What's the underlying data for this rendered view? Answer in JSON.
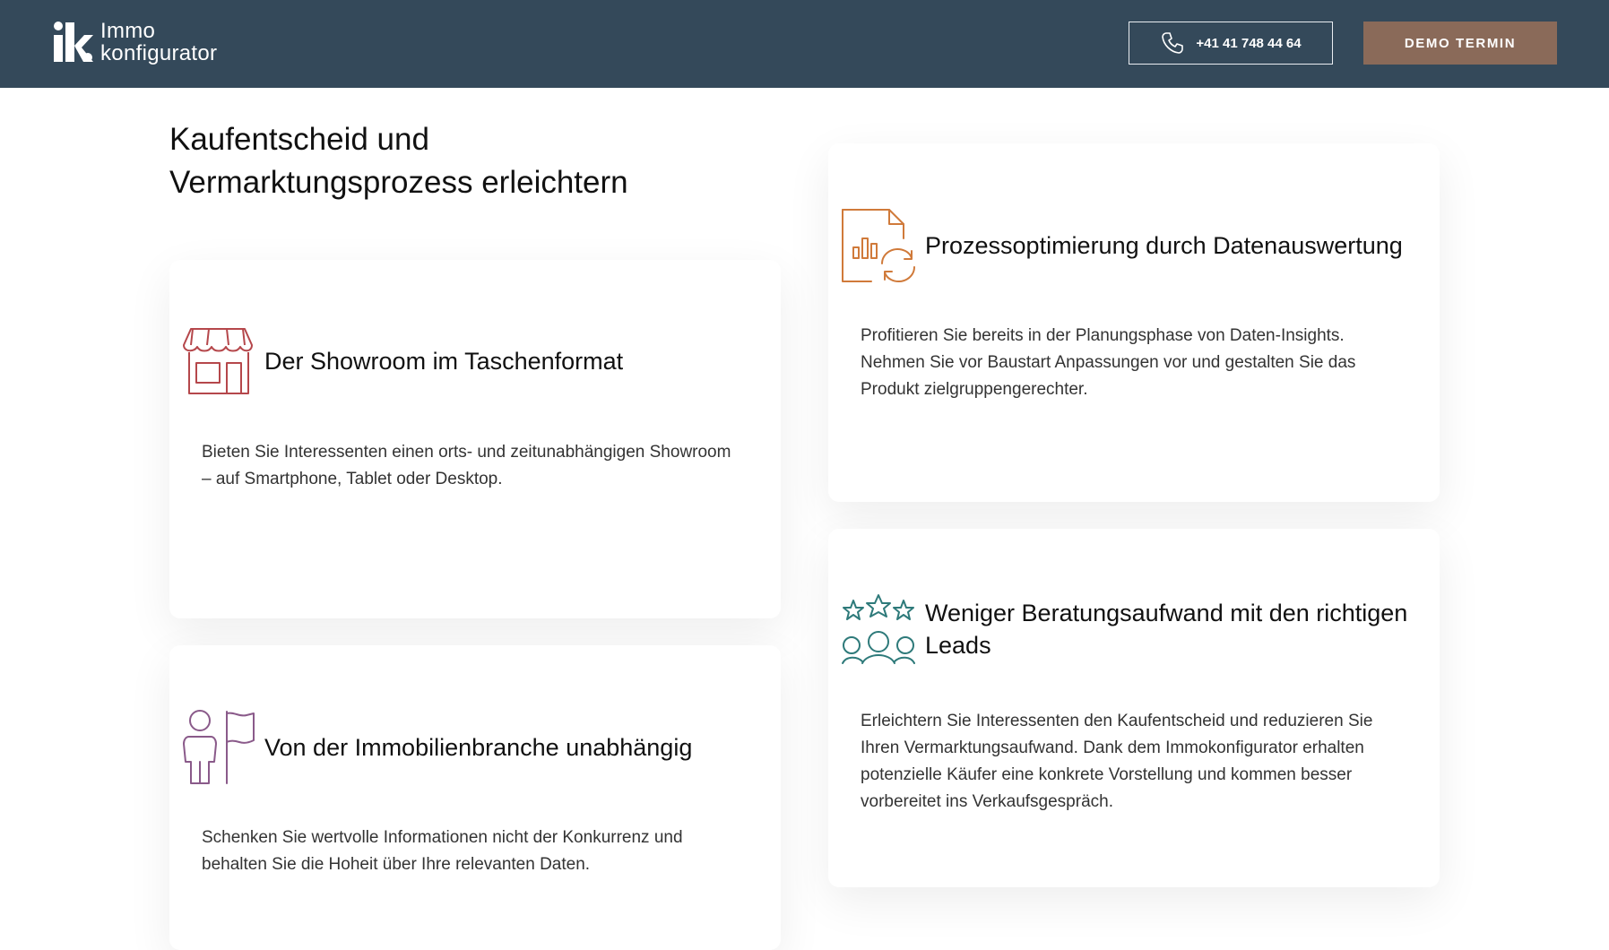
{
  "header": {
    "logo_line1": "Immo",
    "logo_line2": "konfigurator",
    "phone_label": "+41 41 748 44 64",
    "demo_label": "DEMO TERMIN"
  },
  "main": {
    "title_line1": "Kaufentscheid und",
    "title_line2": "Vermarktungsprozess erleichtern",
    "cards": [
      {
        "icon": "showroom-store-icon",
        "title": "Der Showroom im Taschenformat",
        "text_line1": "Bieten Sie Interessenten einen orts- und zeitunabhängigen Showroom",
        "text_line2": "– auf Smartphone, Tablet oder Desktop."
      },
      {
        "icon": "data-chart-refresh-icon",
        "title": "Prozessoptimierung durch Datenauswertung",
        "text_line1": "Profitieren Sie bereits in der Planungsphase von Daten-Insights.",
        "text_line2": "Nehmen Sie vor Baustart Anpassungen vor und gestalten Sie das",
        "text_line3": "Produkt zielgruppengerechter."
      },
      {
        "icon": "person-flag-icon",
        "title": "Von der Immobilienbranche unabhängig",
        "text_line1": "Schenken Sie wertvolle Informationen nicht der Konkurrenz und",
        "text_line2": "behalten Sie die Hoheit über Ihre relevanten Daten."
      },
      {
        "icon": "stars-people-icon",
        "title_line1": "Weniger Beratungsaufwand mit den richtigen",
        "title_line2": "Leads",
        "text_line1": "Erleichtern Sie Interessenten den Kaufentscheid und reduzieren Sie",
        "text_line2": "Ihren Vermarktungsaufwand. Dank dem Immokonfigurator erhalten",
        "text_line3": "potenzielle Käufer eine konkrete Vorstellung und kommen besser",
        "text_line4": "vorbereitet ins Verkaufsgespräch."
      }
    ]
  },
  "colors": {
    "header_bg": "#34495a",
    "demo_button": "#8a6a59",
    "icon_showroom": "#b5474b",
    "icon_data": "#d07a3a",
    "icon_person": "#8a5a8a",
    "icon_stars": "#2e7a7a"
  }
}
